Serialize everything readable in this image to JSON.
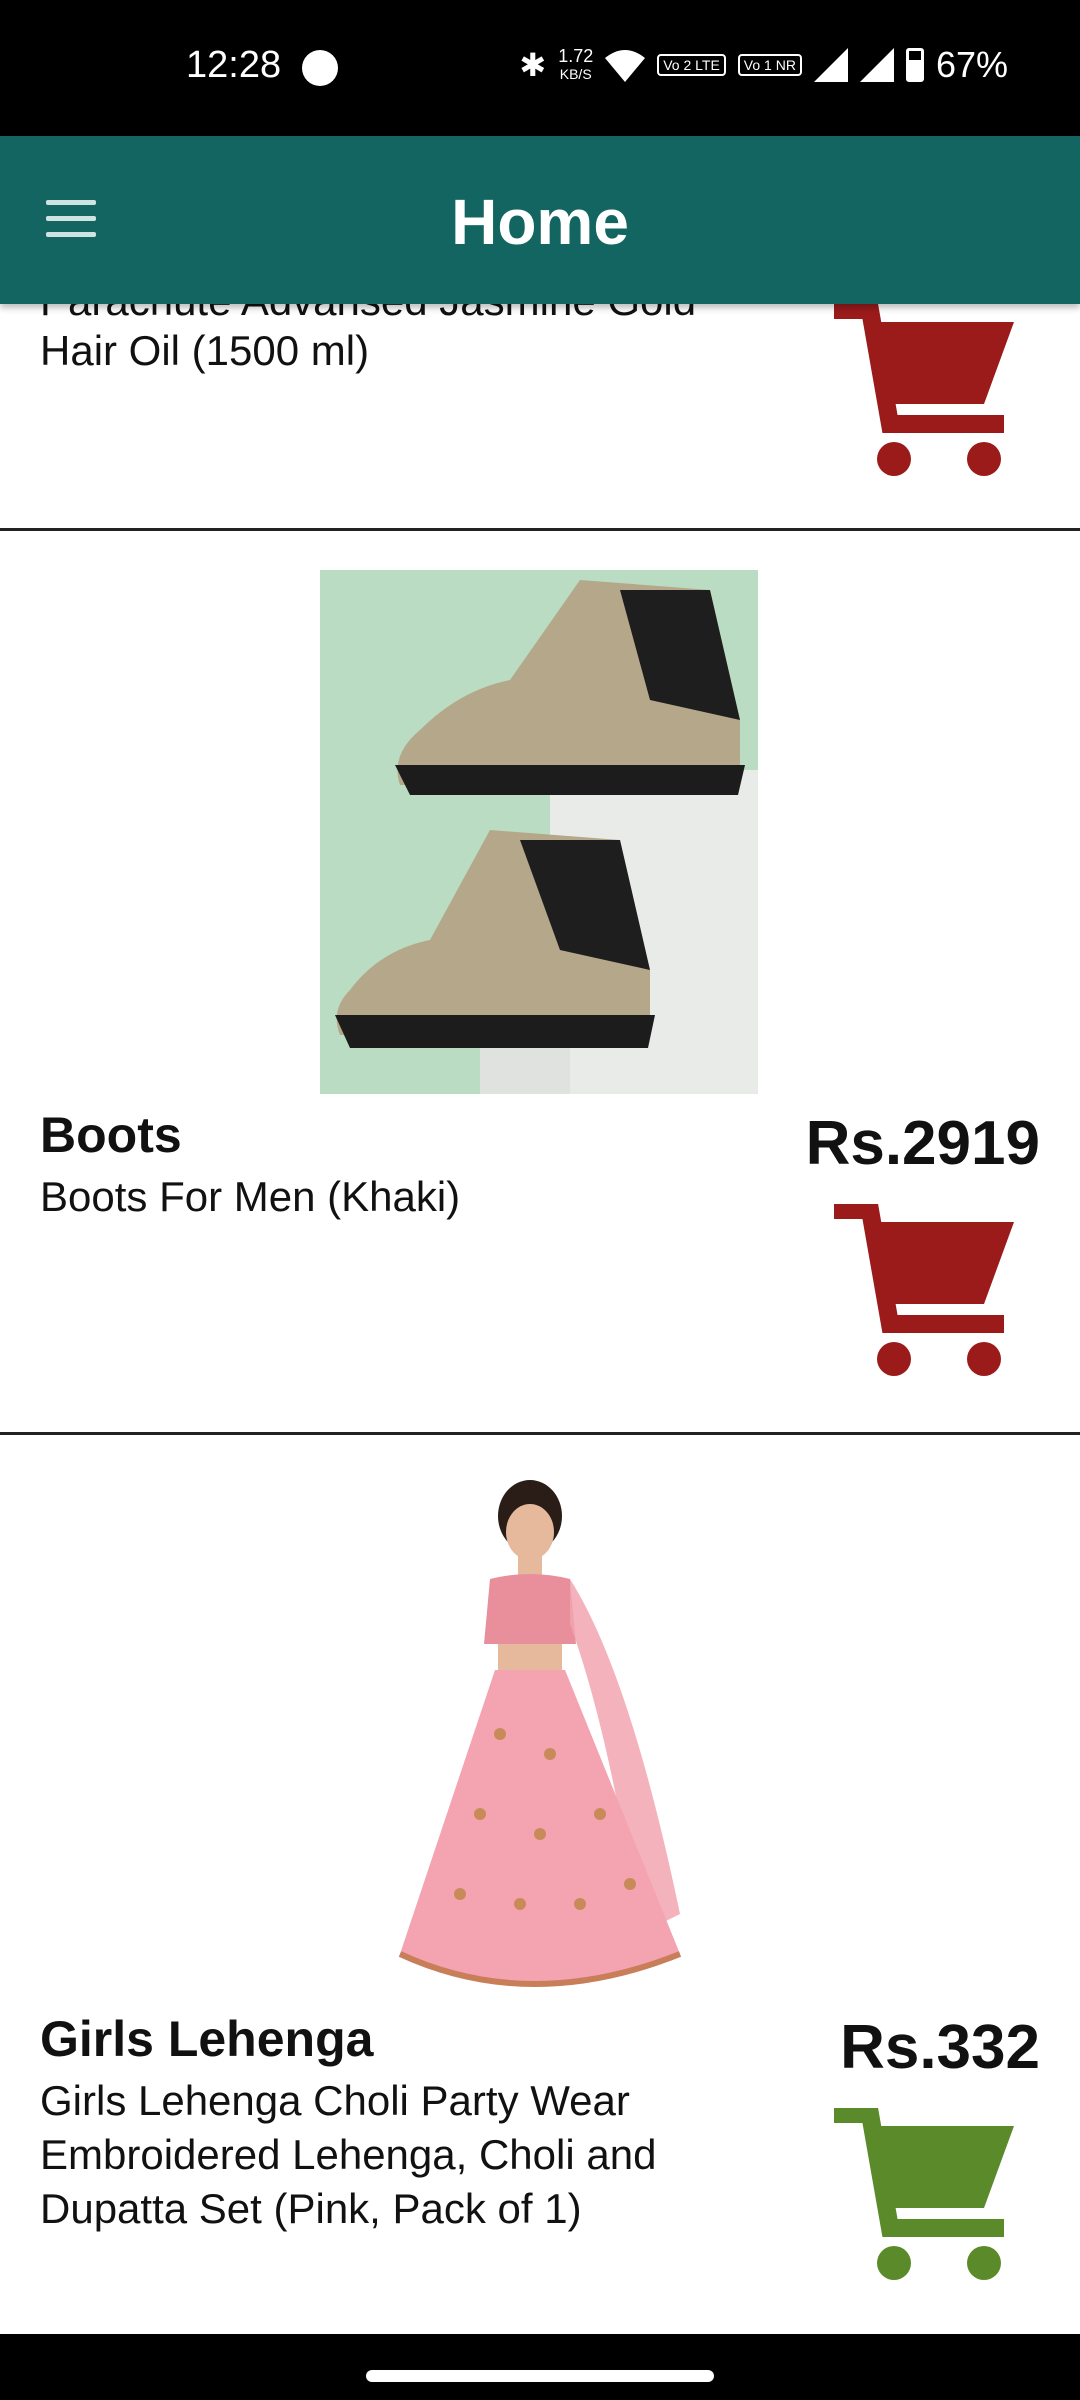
{
  "status_bar": {
    "time": "12:28",
    "net_speed_value": "1.72",
    "net_speed_unit": "KB/S",
    "sim1_badge": "Vo 2 LTE",
    "sim2_badge": "Vo 1 NR",
    "battery": "67%"
  },
  "app_bar": {
    "title": "Home"
  },
  "products": [
    {
      "name_cut": "Parachute Advansed Jasmine Gold",
      "description": "Hair Oil  (1500 ml)",
      "cart_color": "#9b1b1b"
    },
    {
      "name": "Boots",
      "description": "Boots For Men  (Khaki)",
      "price": "Rs.2919",
      "cart_color": "#9b1b1b"
    },
    {
      "name": "Girls Lehenga",
      "description": "Girls Lehenga Choli Party Wear Embroidered Lehenga, Choli and Dupatta Set  (Pink, Pack of 1)",
      "price": "Rs.332",
      "cart_color": "#5a8a2a"
    }
  ],
  "colors": {
    "app_bar": "#136561",
    "cart_red": "#9b1b1b",
    "cart_green": "#5a8a2a"
  }
}
